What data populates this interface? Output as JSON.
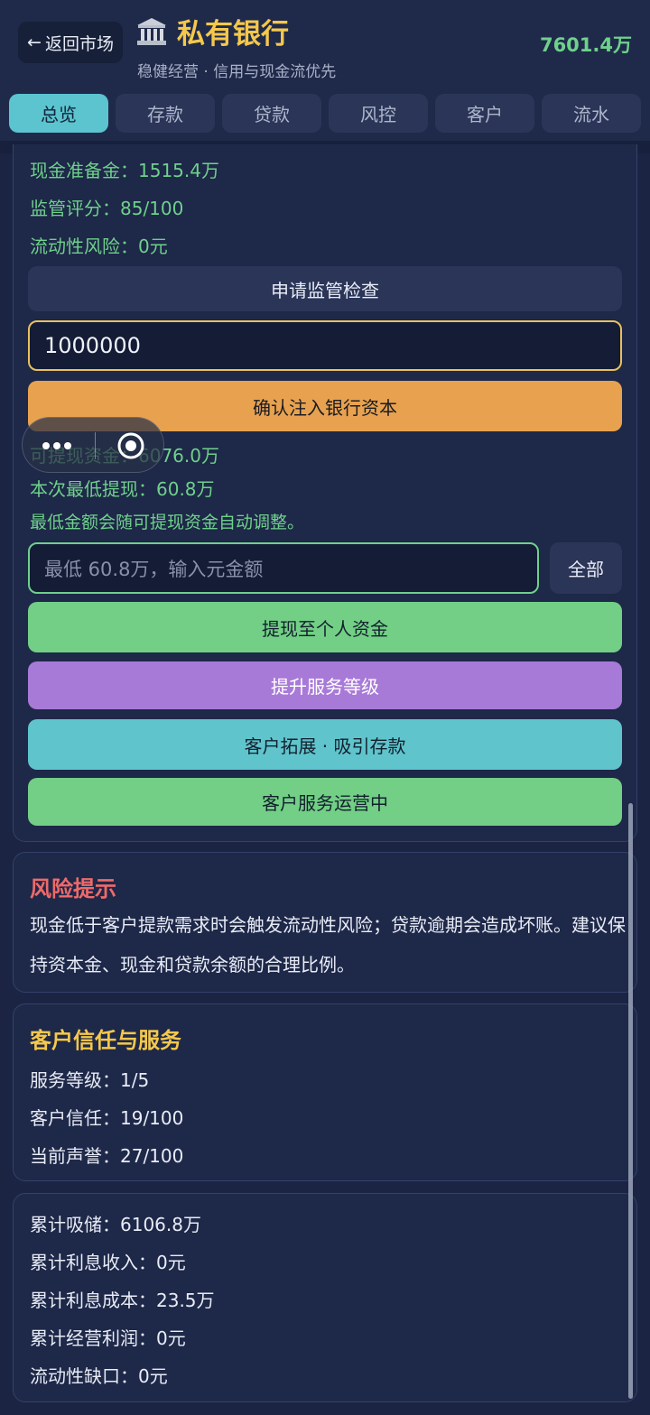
{
  "header": {
    "back_label": "返回市场",
    "title": "私有银行",
    "subtitle": "稳健经营 · 信用与现金流优先",
    "balance": "7601.4万"
  },
  "tabs": [
    {
      "label": "总览",
      "active": true
    },
    {
      "label": "存款",
      "active": false
    },
    {
      "label": "贷款",
      "active": false
    },
    {
      "label": "风控",
      "active": false
    },
    {
      "label": "客户",
      "active": false
    },
    {
      "label": "流水",
      "active": false
    }
  ],
  "overview": {
    "cash_reserve": "现金准备金：1515.4万",
    "regulatory_score": "监管评分：85/100",
    "liquidity_risk": "流动性风险：0元",
    "inspect_label": "申请监管检查",
    "capital_input_value": "1000000",
    "inject_label": "确认注入银行资本",
    "withdrawable": "可提现资金：6076.0万",
    "min_withdraw": "本次最低提现：60.8万",
    "auto_adjust_note": "最低金额会随可提现资金自动调整。",
    "withdraw_placeholder": "最低 60.8万，输入元金额",
    "all_label": "全部",
    "withdraw_label": "提现至个人资金",
    "upgrade_label": "提升服务等级",
    "expand_label": "客户拓展 · 吸引存款",
    "service_label": "客户服务运营中"
  },
  "risk": {
    "title": "风险提示",
    "text": "现金低于客户提款需求时会触发流动性风险；贷款逾期会造成坏账。建议保持资本金、现金和贷款余额的合理比例。"
  },
  "trust": {
    "title": "客户信任与服务",
    "service_level": "服务等级：1/5",
    "trust": "客户信任：19/100",
    "reputation": "当前声誉：27/100"
  },
  "stats": {
    "deposits": "累计吸储：6106.8万",
    "interest_income": "累计利息收入：0元",
    "interest_cost": "累计利息成本：23.5万",
    "operating_profit": "累计经营利润：0元",
    "liquidity_gap": "流动性缺口：0元"
  },
  "colors": {
    "accent_gold": "#f5c84b",
    "accent_green": "#6fd08c",
    "tab_active": "#5bc4cf",
    "risk_red": "#ef6a6a"
  }
}
